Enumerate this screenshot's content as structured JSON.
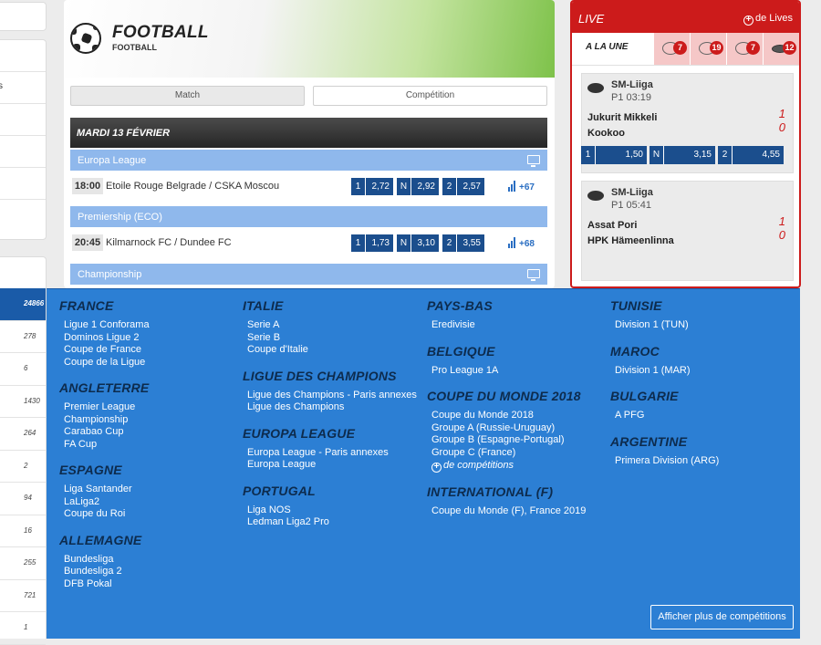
{
  "left_top": [
    "",
    "",
    "s",
    "",
    "",
    "",
    "",
    ""
  ],
  "banner": {
    "title": "FOOTBALL",
    "subtitle": "FOOTBALL"
  },
  "tabs": [
    "Match",
    "Compétition"
  ],
  "day_header": "MARDI 13 FÉVRIER",
  "leagues": [
    "Europa League",
    "Premiership (ECO)",
    "Championship"
  ],
  "matches": [
    {
      "time": "18:00",
      "name": "Etoile Rouge Belgrade / CSKA Moscou",
      "odds": [
        {
          "k": "1",
          "v": "2,72"
        },
        {
          "k": "N",
          "v": "2,92"
        },
        {
          "k": "2",
          "v": "2,57"
        }
      ],
      "more": "+67"
    },
    {
      "time": "20:45",
      "name": "Kilmarnock FC / Dundee FC",
      "odds": [
        {
          "k": "1",
          "v": "1,73"
        },
        {
          "k": "N",
          "v": "3,10"
        },
        {
          "k": "2",
          "v": "3,55"
        }
      ],
      "more": "+68"
    }
  ],
  "live": {
    "title": "LIVE",
    "de_lives": "de Lives",
    "plus_glyph": "+",
    "a_la_une": "A LA UNE",
    "sports": [
      {
        "icon": "football-icon",
        "count": "7"
      },
      {
        "icon": "tennis-icon",
        "count": "19"
      },
      {
        "icon": "basketball-icon",
        "count": "7"
      },
      {
        "icon": "hockey-puck-icon",
        "count": "12"
      }
    ],
    "matches": [
      {
        "league": "SM-Liiga",
        "period": "P1 03:19",
        "team1": "Jukurit Mikkeli",
        "team2": "Kookoo",
        "score1": "1",
        "score2": "0",
        "odds": [
          {
            "k": "1",
            "v": "1,50"
          },
          {
            "k": "N",
            "v": "3,15"
          },
          {
            "k": "2",
            "v": "4,55"
          }
        ]
      },
      {
        "league": "SM-Liiga",
        "period": "P1 05:41",
        "team1": "Assat Pori",
        "team2": "HPK Hämeenlinna",
        "score1": "1",
        "score2": "0"
      }
    ]
  },
  "left_counts": [
    "24866",
    "278",
    "6",
    "1430",
    "264",
    "2",
    "94",
    "16",
    "255",
    "721",
    "1"
  ],
  "menu": {
    "columns": [
      [
        {
          "h": "FRANCE",
          "items": [
            "Ligue 1 Conforama",
            "Dominos Ligue 2",
            "Coupe de France",
            "Coupe de la Ligue"
          ]
        },
        {
          "h": "ANGLETERRE",
          "items": [
            "Premier League",
            "Championship",
            "Carabao Cup",
            "FA Cup"
          ]
        },
        {
          "h": "ESPAGNE",
          "items": [
            "Liga Santander",
            "LaLiga2",
            "Coupe du Roi"
          ]
        },
        {
          "h": "ALLEMAGNE",
          "items": [
            "Bundesliga",
            "Bundesliga 2",
            "DFB Pokal"
          ]
        }
      ],
      [
        {
          "h": "ITALIE",
          "items": [
            "Serie A",
            "Serie B",
            "Coupe d'Italie"
          ]
        },
        {
          "h": "LIGUE DES CHAMPIONS",
          "items": [
            "Ligue des Champions - Paris annexes",
            "Ligue des Champions"
          ]
        },
        {
          "h": "EUROPA LEAGUE",
          "items": [
            "Europa League - Paris annexes",
            "Europa League"
          ]
        },
        {
          "h": "PORTUGAL",
          "items": [
            "Liga NOS",
            "Ledman Liga2 Pro"
          ]
        }
      ],
      [
        {
          "h": "PAYS-BAS",
          "items": [
            "Eredivisie"
          ]
        },
        {
          "h": "BELGIQUE",
          "items": [
            "Pro League 1A"
          ]
        },
        {
          "h": "COUPE DU MONDE 2018",
          "items": [
            "Coupe du Monde 2018",
            "Groupe A (Russie-Uruguay)",
            "Groupe B (Espagne-Portugal)",
            "Groupe C (France)"
          ],
          "more": "de compétitions"
        },
        {
          "h": "INTERNATIONAL (F)",
          "items": [
            "Coupe du Monde (F), France 2019"
          ]
        }
      ],
      [
        {
          "h": "TUNISIE",
          "items": [
            "Division 1 (TUN)"
          ]
        },
        {
          "h": "MAROC",
          "items": [
            "Division 1 (MAR)"
          ]
        },
        {
          "h": "BULGARIE",
          "items": [
            "A PFG"
          ]
        },
        {
          "h": "ARGENTINE",
          "items": [
            "Primera Division (ARG)"
          ]
        }
      ]
    ],
    "show_more": "Afficher plus de compétitions"
  }
}
